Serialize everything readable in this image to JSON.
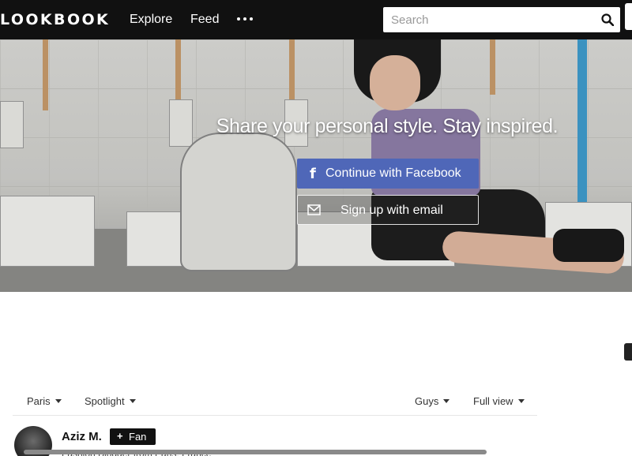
{
  "header": {
    "logo": "LOOKBOOK",
    "nav": [
      {
        "label": "Explore"
      },
      {
        "label": "Feed"
      }
    ],
    "more_icon": "more-dots-icon",
    "search": {
      "placeholder": "Search",
      "value": "",
      "icon": "search-icon"
    }
  },
  "hero": {
    "tagline": "Share your personal style. Stay inspired.",
    "facebook_button": {
      "label": "Continue with Facebook",
      "icon": "facebook-icon",
      "color": "#4f67b8"
    },
    "email_button": {
      "label": "Sign up with email",
      "icon": "mail-icon"
    }
  },
  "filters": {
    "location": "Paris",
    "sort": "Spotlight",
    "gender": "Guys",
    "view": "Full view"
  },
  "post": {
    "user_name": "Aziz M.",
    "fan_button": "Fan",
    "bio": "Fashion Blogger from Paris, France"
  },
  "colors": {
    "nav_background": "#111111",
    "facebook_blue": "#4f67b8"
  }
}
